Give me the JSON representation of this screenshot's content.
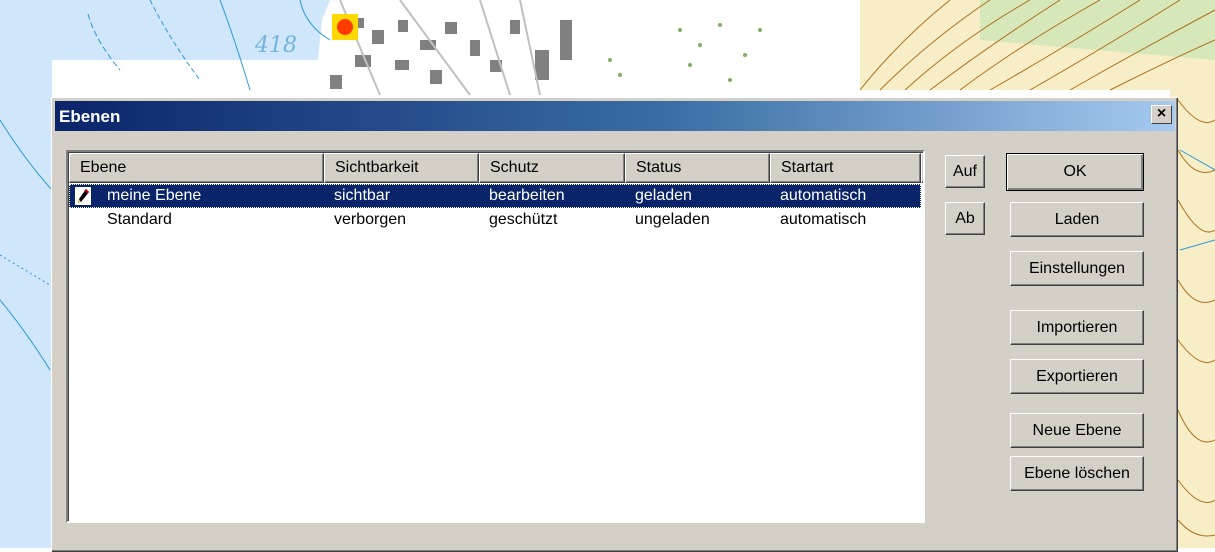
{
  "map": {
    "label": "418",
    "colors": {
      "water": "#cfe6fb",
      "contour": "#b07020",
      "forest": "#a8d8a0",
      "buildings": "#808080",
      "marker": "#ff3b00",
      "marker_bg": "#ffd800"
    }
  },
  "dialog": {
    "title": "Ebenen",
    "close_label": "×",
    "columns": [
      "Ebene",
      "Sichtbarkeit",
      "Schutz",
      "Status",
      "Startart"
    ],
    "rows": [
      {
        "ebene": "meine Ebene",
        "sichtbarkeit": "sichtbar",
        "schutz": "bearbeiten",
        "status": "geladen",
        "startart": "automatisch",
        "selected": true,
        "icon": "pencil-icon"
      },
      {
        "ebene": "Standard",
        "sichtbarkeit": "verborgen",
        "schutz": "geschützt",
        "status": "ungeladen",
        "startart": "automatisch",
        "selected": false
      }
    ],
    "buttons": {
      "up": "Auf",
      "down": "Ab",
      "ok": "OK",
      "load": "Laden",
      "settings": "Einstellungen",
      "import": "Importieren",
      "export": "Exportieren",
      "new_layer": "Neue Ebene",
      "delete_layer": "Ebene löschen"
    },
    "colors": {
      "face": "#d4d0c8",
      "selection": "#0a246a",
      "title_start": "#0a246a",
      "title_end": "#a6caf0"
    }
  }
}
